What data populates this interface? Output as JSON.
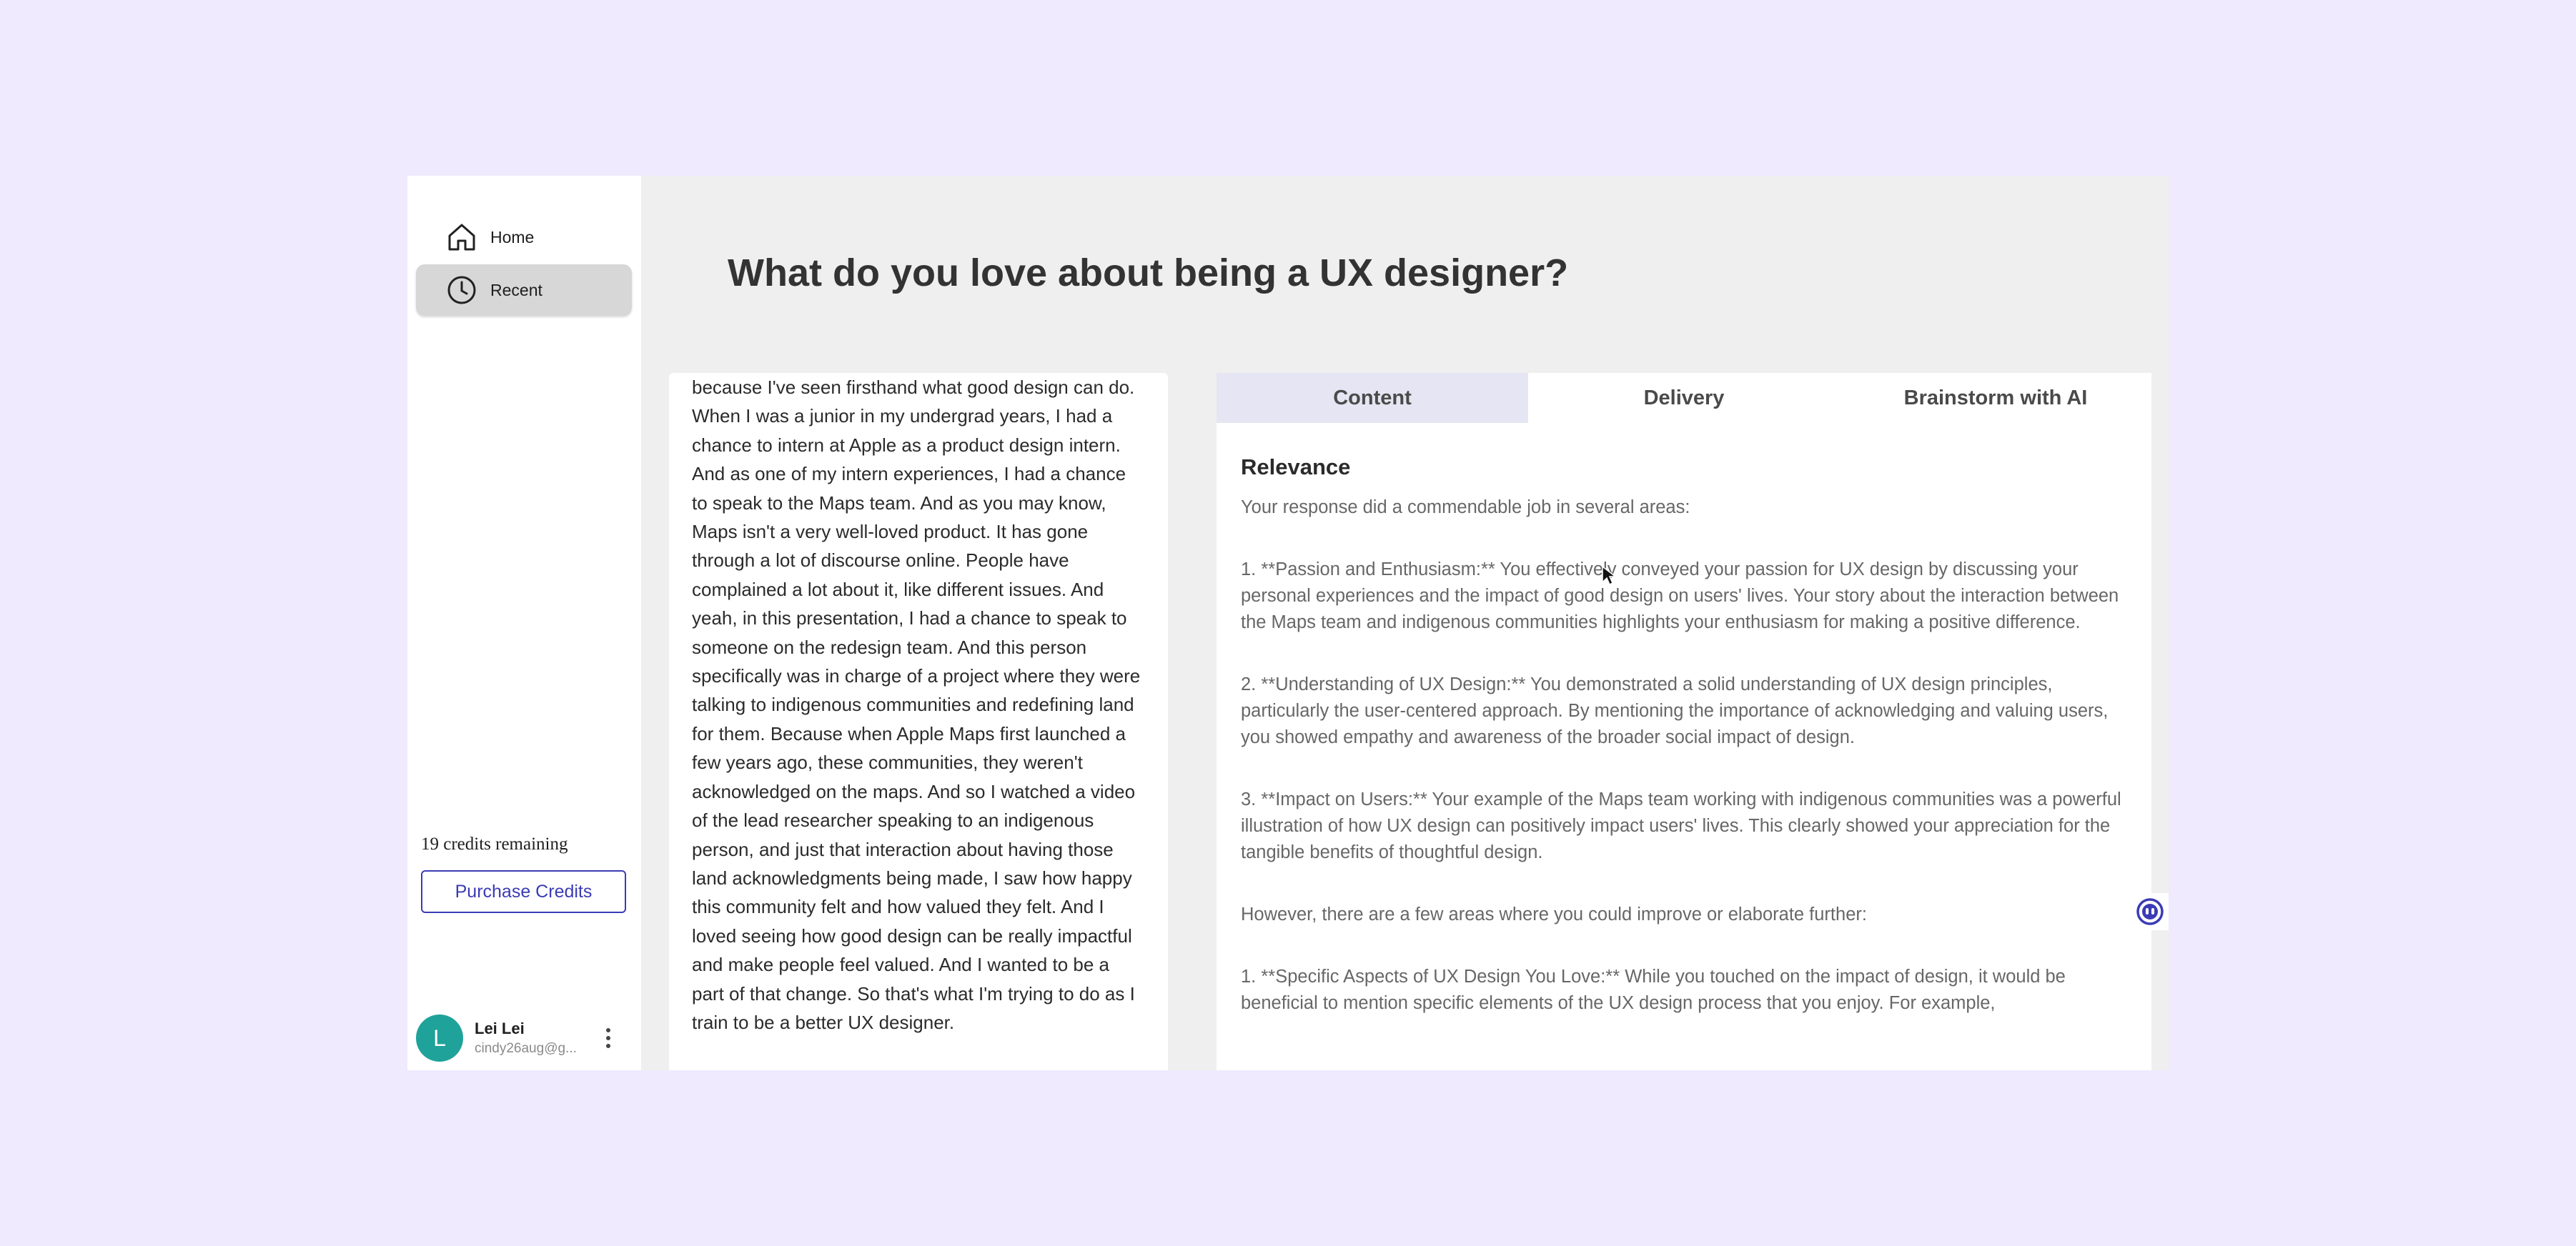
{
  "sidebar": {
    "items": [
      {
        "label": "Home",
        "icon": "home-icon"
      },
      {
        "label": "Recent",
        "icon": "clock-icon",
        "active": true
      }
    ],
    "credits_text": "19 credits remaining",
    "purchase_label": "Purchase Credits",
    "user": {
      "initial": "L",
      "name": "Lei Lei",
      "email": "cindy26aug@g..."
    }
  },
  "main": {
    "question": "What do you love about being a UX designer?",
    "transcript": "because I've seen firsthand what good design can do. When I was a junior in my undergrad years, I had a chance to intern at Apple as a product design intern. And as one of my intern experiences, I had a chance to speak to the Maps team. And as you may know, Maps isn't a very well-loved product. It has gone through a lot of discourse online. People have complained a lot about it, like different issues. And yeah, in this presentation, I had a chance to speak to someone on the redesign team. And this person specifically was in charge of a project where they were talking to indigenous communities and redefining land for them. Because when Apple Maps first launched a few years ago, these communities, they weren't acknowledged on the maps. And so I watched a video of the lead researcher speaking to an indigenous person, and just that interaction about having those land acknowledgments being made, I saw how happy this community felt and how valued they felt. And I loved seeing how good design can be really impactful and make people feel valued. And I wanted to be a part of that change. So that's what I'm trying to do as I train to be a better UX designer.",
    "tabs": [
      {
        "label": "Content",
        "active": true
      },
      {
        "label": "Delivery"
      },
      {
        "label": "Brainstorm with AI"
      }
    ],
    "feedback": {
      "title": "Relevance",
      "intro": "Your response did a commendable job in several areas:",
      "paragraphs": [
        "1. **Passion and Enthusiasm:** You effectively conveyed your passion for UX design by discussing your personal experiences and the impact of good design on users' lives. Your story about the interaction between the Maps team and indigenous communities highlights your enthusiasm for making a positive difference.",
        "2. **Understanding of UX Design:** You demonstrated a solid understanding of UX design principles, particularly the user-centered approach. By mentioning the importance of acknowledging and valuing users, you showed empathy and awareness of the broader social impact of design.",
        "3. **Impact on Users:** Your example of the Maps team working with indigenous communities was a powerful illustration of how UX design can positively impact users' lives. This clearly showed your appreciation for the tangible benefits of thoughtful design.",
        "However, there are a few areas where you could improve or elaborate further:",
        "1. **Specific Aspects of UX Design You Love:** While you touched on the impact of design, it would be beneficial to mention specific elements of the UX design process that you enjoy. For example,"
      ]
    }
  },
  "colors": {
    "page_bg": "#efeafd",
    "accent": "#3b3bb5",
    "avatar": "#1fa29a",
    "active_tab": "#e6e5f3"
  }
}
